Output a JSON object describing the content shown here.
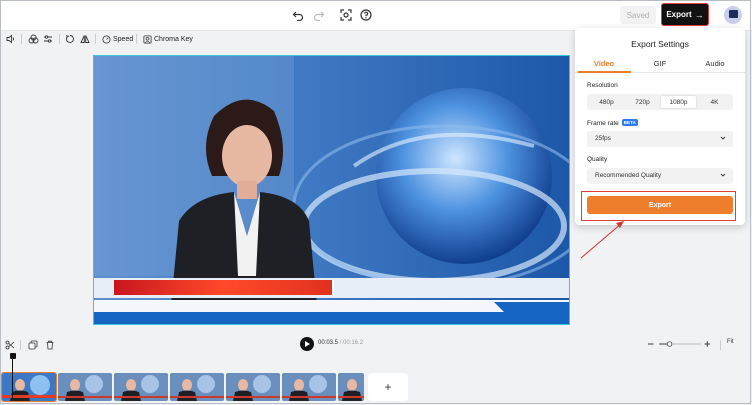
{
  "topbar": {
    "undo_icon": "undo-icon",
    "redo_icon": "redo-icon",
    "screenshot_icon": "screenshot-icon",
    "help_icon": "help-icon",
    "saved_label": "Saved",
    "export_label": "Export",
    "avatar_icon": "avatar-icon"
  },
  "toolbar": {
    "speed_label": "Speed",
    "chroma_key_label": "Chroma Key"
  },
  "export_panel": {
    "title": "Export Settings",
    "tabs": [
      {
        "label": "Video",
        "active": true
      },
      {
        "label": "GIF",
        "active": false
      },
      {
        "label": "Audio",
        "active": false
      }
    ],
    "resolution": {
      "label": "Resolution",
      "options": [
        "480p",
        "720p",
        "1080p",
        "4K"
      ],
      "selected": "1080p"
    },
    "frame_rate": {
      "label": "Frame rate",
      "badge": "BETA",
      "value": "25fps"
    },
    "quality": {
      "label": "Quality",
      "value": "Recommended Quality"
    },
    "export_button": "Export"
  },
  "playback": {
    "current_time": "00:03.5",
    "separator": " / ",
    "duration": "00:16.2",
    "fit_label": "Fit"
  },
  "timeline": {
    "add_label": "+"
  },
  "colors": {
    "accent": "#ee7d2c",
    "highlight": "#e23b3b",
    "canvas_border": "#39c6d8"
  }
}
